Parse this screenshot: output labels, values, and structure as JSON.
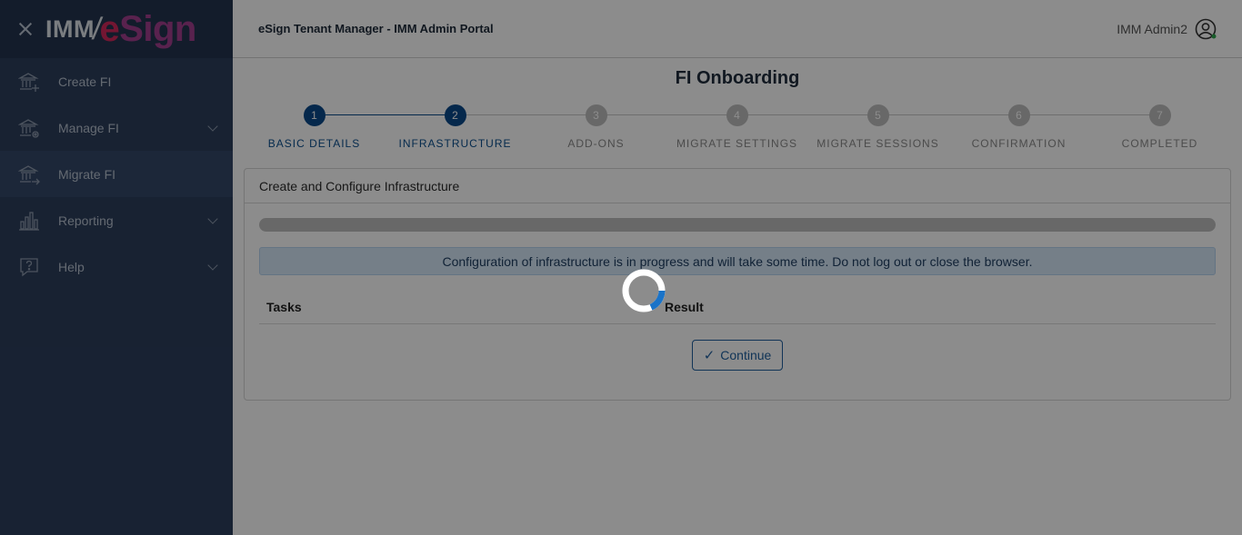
{
  "sidebar": {
    "logo_imm": "IMM",
    "logo_slash": "/",
    "logo_e": "e",
    "logo_sign": "Sign",
    "items": [
      {
        "label": "Create FI",
        "icon": "bank-add-icon",
        "has_chevron": false
      },
      {
        "label": "Manage FI",
        "icon": "bank-settings-icon",
        "has_chevron": true
      },
      {
        "label": "Migrate FI",
        "icon": "bank-migrate-icon",
        "has_chevron": false,
        "active": true
      },
      {
        "label": "Reporting",
        "icon": "bar-chart-icon",
        "has_chevron": true
      },
      {
        "label": "Help",
        "icon": "help-icon",
        "has_chevron": true
      }
    ]
  },
  "header": {
    "title": "eSign Tenant Manager - IMM Admin Portal",
    "user_name": "IMM Admin2",
    "user_icon": "user-account-icon"
  },
  "page": {
    "title": "FI Onboarding",
    "steps": [
      {
        "number": "1",
        "label": "BASIC DETAILS",
        "state": "done"
      },
      {
        "number": "2",
        "label": "INFRASTRUCTURE",
        "state": "done"
      },
      {
        "number": "3",
        "label": "ADD-ONS",
        "state": "todo"
      },
      {
        "number": "4",
        "label": "MIGRATE SETTINGS",
        "state": "todo"
      },
      {
        "number": "5",
        "label": "MIGRATE SESSIONS",
        "state": "todo"
      },
      {
        "number": "6",
        "label": "CONFIRMATION",
        "state": "todo"
      },
      {
        "number": "7",
        "label": "COMPLETED",
        "state": "todo"
      }
    ]
  },
  "panel": {
    "header": "Create and Configure Infrastructure",
    "progress_fraction": 1.0,
    "info_message": "Configuration of infrastructure is in progress and will take some time. Do not log out or close the browser.",
    "col_tasks": "Tasks",
    "col_result": "Result",
    "continue_label": "Continue",
    "continue_icon": "check-icon"
  },
  "colors": {
    "sidebar_bg": "#2c3e5c",
    "accent": "#0a4a8a",
    "spinner": "#1a73c8"
  }
}
